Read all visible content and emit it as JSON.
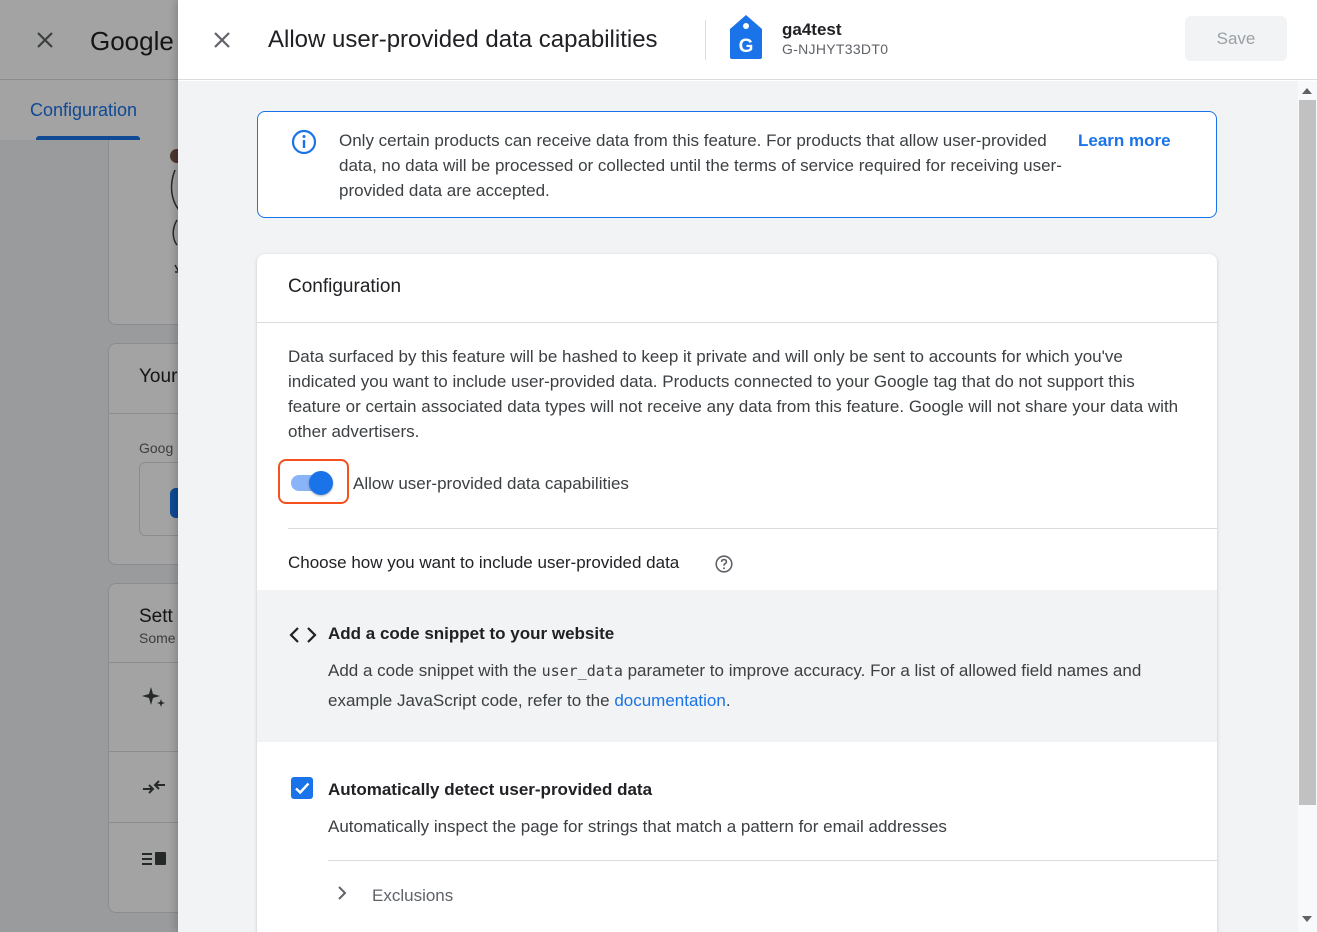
{
  "background": {
    "title": "Google",
    "tab": "Configuration",
    "card2_title": "Your",
    "card2_sub": "Goog",
    "card3_title": "Sett",
    "card3_sub": "Some"
  },
  "dialog": {
    "title": "Allow user-provided data capabilities",
    "tag_name": "ga4test",
    "tag_id": "G-NJHYT33DT0",
    "tag_letter": "G",
    "save_label": "Save"
  },
  "info": {
    "text": "Only certain products can receive data from this feature. For products that allow user-provided data, no data will be processed or collected until the terms of service required for receiving user-provided data are accepted.",
    "learn_more": "Learn more"
  },
  "config": {
    "title": "Configuration",
    "description": "Data surfaced by this feature will be hashed to keep it private and will only be sent to accounts for which you've indicated you want to include user-provided data. Products connected to your Google tag that do not support this feature or certain associated data types will not receive any data from this feature. Google will not share your data with other advertisers.",
    "toggle_label": "Allow user-provided data capabilities",
    "toggle_on": true,
    "choose_label": "Choose how you want to include user-provided data",
    "snippet": {
      "title": "Add a code snippet to your website",
      "desc_before": "Add a code snippet with the ",
      "desc_code": "user_data",
      "desc_after": " parameter to improve accuracy. For a list of allowed field names and example JavaScript code, refer to the ",
      "doc_link": "documentation",
      "desc_end": "."
    },
    "auto_detect": {
      "title": "Automatically detect user-provided data",
      "desc": "Automatically inspect the page for strings that match a pattern for email addresses",
      "checked": true
    },
    "exclusions_label": "Exclusions"
  },
  "colors": {
    "accent": "#1a73e8",
    "focus_ring": "#f4511e"
  }
}
